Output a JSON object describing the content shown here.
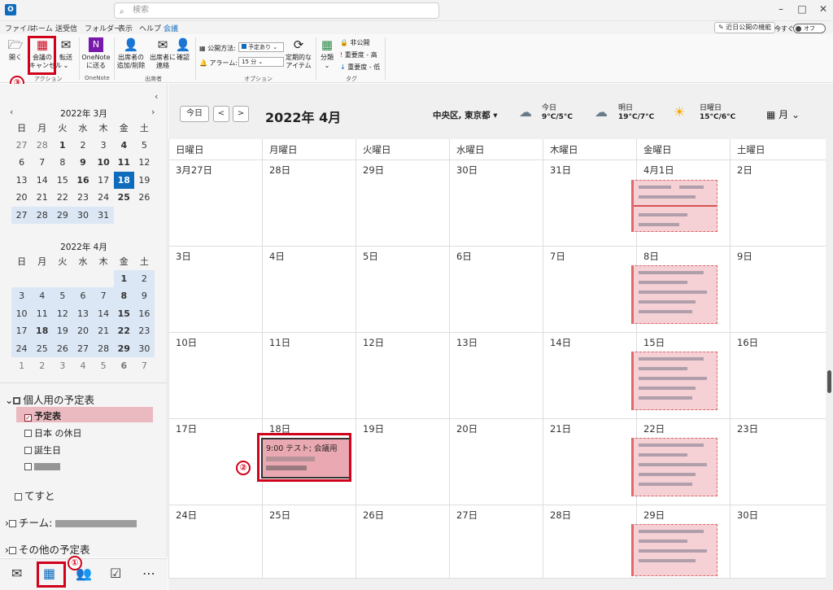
{
  "titlebar": {
    "search_placeholder": "検索",
    "app_icon": "O"
  },
  "menu": [
    "ファイル",
    "ホーム",
    "送受信",
    "フォルダー",
    "表示",
    "ヘルプ",
    "会議"
  ],
  "menu_active": "会議",
  "top_right": {
    "feature_label": "近日公開の機能",
    "try_label": "今すぐ試す",
    "toggle_label": "オフ"
  },
  "ribbon": {
    "open": "開く",
    "cancel_meeting": "会議の\nキャンセル",
    "forward": "転送",
    "onenote": "OneNote\nに送る",
    "attendee_addremove": "出席者の\n追加/削除",
    "contact_attendees": "出席者に\n連絡",
    "confirm": "確認",
    "show_as_label": "公開方法:",
    "show_as_value": "予定あり",
    "reminder_label": "アラーム:",
    "reminder_value": "15 分",
    "recurrence": "定期的な\nアイテム",
    "categorize": "分類",
    "private": "非公開",
    "high_importance": "重要度 - 高",
    "low_importance": "重要度 - 低",
    "group_actions": "アクション",
    "group_onenote": "OneNote",
    "group_attendees": "出席者",
    "group_options": "オプション",
    "group_tags": "タグ"
  },
  "callouts": [
    "①",
    "②",
    "③"
  ],
  "mini_march": {
    "title": "2022年 3月",
    "weekdays": [
      "日",
      "月",
      "火",
      "水",
      "木",
      "金",
      "土"
    ],
    "rows": [
      [
        "27",
        "28",
        "1",
        "2",
        "3",
        "4",
        "5"
      ],
      [
        "6",
        "7",
        "8",
        "9",
        "10",
        "11",
        "12"
      ],
      [
        "13",
        "14",
        "15",
        "16",
        "17",
        "18",
        "19"
      ],
      [
        "20",
        "21",
        "22",
        "23",
        "24",
        "25",
        "26"
      ],
      [
        "27",
        "28",
        "29",
        "30",
        "31",
        "",
        ""
      ]
    ]
  },
  "mini_april": {
    "title": "2022年 4月",
    "weekdays": [
      "日",
      "月",
      "火",
      "水",
      "木",
      "金",
      "土"
    ],
    "rows": [
      [
        "",
        "",
        "",
        "",
        "",
        "1",
        "2"
      ],
      [
        "3",
        "4",
        "5",
        "6",
        "7",
        "8",
        "9"
      ],
      [
        "10",
        "11",
        "12",
        "13",
        "14",
        "15",
        "16"
      ],
      [
        "17",
        "18",
        "19",
        "20",
        "21",
        "22",
        "23"
      ],
      [
        "24",
        "25",
        "26",
        "27",
        "28",
        "29",
        "30"
      ],
      [
        "1",
        "2",
        "3",
        "4",
        "5",
        "6",
        "7"
      ]
    ]
  },
  "calendars": {
    "group": "個人用の予定表",
    "items": [
      "予定表",
      "日本 の休日",
      "誕生日"
    ],
    "other": [
      "てすと",
      "チーム:",
      "その他の予定表"
    ]
  },
  "toolbar": {
    "today": "今日",
    "prev": "<",
    "next": ">",
    "title": "2022年 4月",
    "location": "中央区, 東京都",
    "view": "月"
  },
  "weather": [
    {
      "day": "今日",
      "temp": "9°C/5°C"
    },
    {
      "day": "明日",
      "temp": "19°C/7°C"
    },
    {
      "day": "日曜日",
      "temp": "15°C/6°C"
    }
  ],
  "weekday_headers": [
    "日曜日",
    "月曜日",
    "火曜日",
    "水曜日",
    "木曜日",
    "金曜日",
    "土曜日"
  ],
  "weeks": [
    [
      "3月27日",
      "28日",
      "29日",
      "30日",
      "31日",
      "4月1日",
      "2日"
    ],
    [
      "3日",
      "4日",
      "5日",
      "6日",
      "7日",
      "8日",
      "9日"
    ],
    [
      "10日",
      "11日",
      "12日",
      "13日",
      "14日",
      "15日",
      "16日"
    ],
    [
      "17日",
      "18日",
      "19日",
      "20日",
      "21日",
      "22日",
      "23日"
    ],
    [
      "24日",
      "25日",
      "26日",
      "27日",
      "28日",
      "29日",
      "30日"
    ]
  ],
  "selected_event": {
    "text": "9:00 テスト; 会議用"
  },
  "colors": {
    "accent": "#0f6cbd",
    "event": "#f5d0d4",
    "callout": "#d0021b"
  }
}
